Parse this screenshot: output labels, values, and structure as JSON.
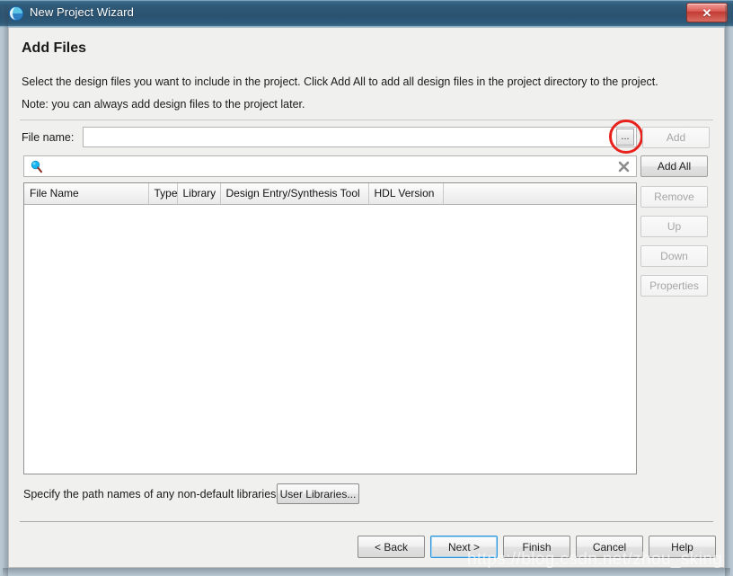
{
  "window": {
    "title": "New Project Wizard",
    "app_icon": "quartus-globe-icon",
    "close_label": "✕"
  },
  "page": {
    "heading": "Add Files",
    "description": "Select the design files you want to include in the project. Click Add All to add all design files in the project directory to the project.",
    "note": "Note: you can always add design files to the project later."
  },
  "file_name": {
    "label": "File name:",
    "value": "",
    "placeholder": "",
    "browse_label": "...",
    "browse_icon": "ellipsis-icon",
    "highlight_color": "#e8211c"
  },
  "search": {
    "value": "",
    "placeholder": "",
    "search_icon": "magnifier-icon",
    "clear_icon": "clear-x-icon"
  },
  "table": {
    "columns": [
      "File Name",
      "Type",
      "Library",
      "Design Entry/Synthesis Tool",
      "HDL Version",
      ""
    ],
    "rows": []
  },
  "side_buttons": [
    {
      "label": "Add",
      "enabled": false
    },
    {
      "label": "Add All",
      "enabled": true
    },
    {
      "label": "Remove",
      "enabled": false
    },
    {
      "label": "Up",
      "enabled": false
    },
    {
      "label": "Down",
      "enabled": false
    },
    {
      "label": "Properties",
      "enabled": false
    }
  ],
  "libraries": {
    "text": "Specify the path names of any non-default libraries.",
    "button_label": "User Libraries..."
  },
  "nav_buttons": [
    {
      "label": "< Back",
      "default": false
    },
    {
      "label": "Next >",
      "default": true
    },
    {
      "label": "Finish",
      "default": false
    },
    {
      "label": "Cancel",
      "default": false
    },
    {
      "label": "Help",
      "default": false
    }
  ],
  "watermark": "https://blog.csdn.net/zhou_sking"
}
